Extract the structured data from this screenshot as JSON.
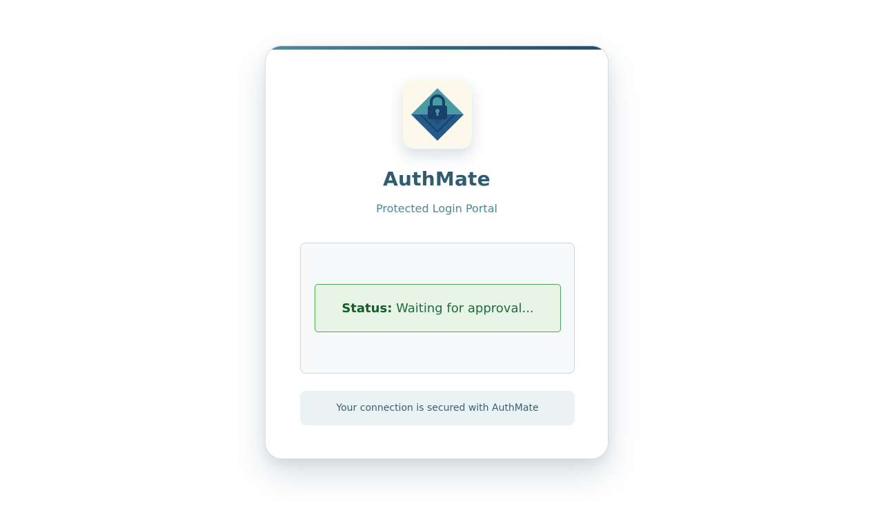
{
  "app": {
    "name": "AuthMate",
    "subtitle": "Protected Login Portal",
    "logo_icon": "lock-envelope-icon"
  },
  "status": {
    "label": "Status:",
    "value": "Waiting for approval..."
  },
  "footer": {
    "note": "Your connection is secured with AuthMate"
  },
  "colors": {
    "accent": "#2f5c6f",
    "subtitle": "#4a8a98",
    "status_text": "#135c2c",
    "status_bg": "#e8f4e6",
    "status_border": "#4caa4f",
    "logo_bg": "#fdf8ec",
    "logo_teal": "#4a9aa3",
    "logo_navy": "#1f4e7a"
  }
}
